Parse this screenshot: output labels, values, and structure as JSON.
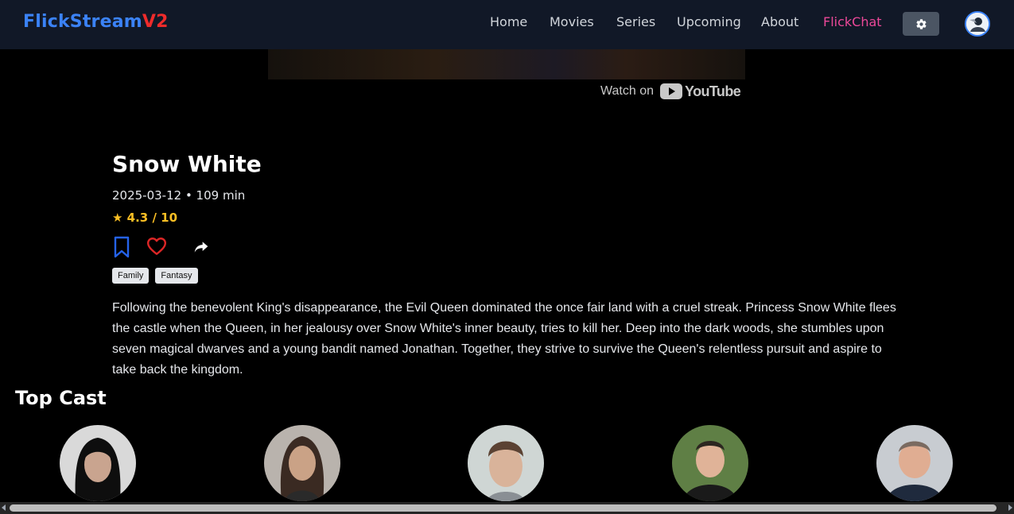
{
  "brand": {
    "part1": "FlickStream",
    "part2": "V2"
  },
  "nav": {
    "items": [
      {
        "label": "Home"
      },
      {
        "label": "Movies"
      },
      {
        "label": "Series"
      },
      {
        "label": "Upcoming"
      },
      {
        "label": "About"
      },
      {
        "label": "FlickChat"
      }
    ],
    "theme_icon": "gear-icon",
    "avatar_icon": "user-avatar"
  },
  "video": {
    "watch_on": "Watch on",
    "provider": "YouTube"
  },
  "movie": {
    "title": "Snow White",
    "meta": "2025-03-12 • 109 min",
    "rating": "★ 4.3 / 10",
    "genres": [
      "Family",
      "Fantasy"
    ],
    "overview": "Following the benevolent King's disappearance, the Evil Queen dominated the once fair land with a cruel streak. Princess Snow White flees the castle when the Queen, in her jealousy over Snow White's inner beauty, tries to kill her. Deep into the dark woods, she stumbles upon seven magical dwarves and a young bandit named Jonathan. Together, they strive to survive the Queen's relentless pursuit and aspire to take back the kingdom."
  },
  "actions": {
    "bookmark_icon": "bookmark-icon",
    "favorite_icon": "heart-icon",
    "share_icon": "share-icon"
  },
  "cast": {
    "heading": "Top Cast",
    "count": 5
  },
  "colors": {
    "nav_bg": "#111827",
    "brand_blue": "#3b82f6",
    "brand_red": "#ef2b2b",
    "flickchat_pink": "#ec4899",
    "rating_gold": "#fbbf24",
    "page_bg": "#000000"
  }
}
